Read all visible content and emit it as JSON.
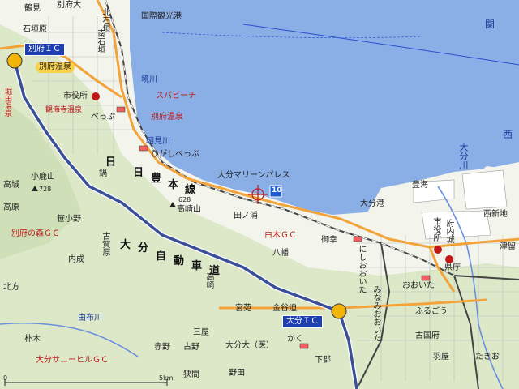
{
  "map": {
    "water_color": "#8aaee6",
    "land_color": "#f3f4ec",
    "hill_color": "#dde8c8",
    "expressway_color": "#3a4f97",
    "route_color": "#f2a33a",
    "rail_color": "#444444",
    "labels": {
      "tsurumi": "鶴見",
      "ishigakibara": "石垣原",
      "beppu_sta_n": "別府大",
      "kitaishigaki": "北石垣",
      "minamiishigaki": "南石垣",
      "kokusai_port": "国際観光港",
      "seki": "関",
      "nishi": "西",
      "sakaigawa": "境川",
      "supabeach": "スパビーチ",
      "shiyakusho_beppu": "市役所",
      "beppu_station": "べっぷ",
      "beppu_onsen_label": "別府温泉",
      "kankaiji": "観海寺温泉",
      "horita": "堀田温泉",
      "asamigawa": "朝見川",
      "higashi_beppu": "ひがしべっぷ",
      "oita_marine": "大分マリーンパレス",
      "oitagawa": "大分川",
      "takasaki": "高崎山",
      "takasaki_elev": "628",
      "kobuyama": "小鹿山",
      "kobuyama_elev": "728",
      "tanoura": "田ノ浦",
      "kashima": "鍋",
      "sasao": "笹小野",
      "koga": "古賀原",
      "beppu_forest": "別府の森ＧＣ",
      "uchinari": "内成",
      "shiraki_gc": "白木ＧＣ",
      "hachiman": "八幡",
      "gohashi": "御幸",
      "oita_port": "大分港",
      "toyoumi": "豊海",
      "nishishinchi": "西新地",
      "shiyakusho_oita": "市役所",
      "funai": "府内城",
      "kencho": "県庁",
      "tsuhara": "津留",
      "nishioita": "にしおおいた",
      "minamioita": "みなみおおいた",
      "oita_station": "おおいた",
      "furugou": "ふるごう",
      "kanaike": "金谷迫",
      "miyaen": "宮苑",
      "sanmyo": "三屋",
      "furuno": "古野",
      "akano": "赤野",
      "oita_univ": "大分大（医）",
      "kaku": "かく",
      "noda": "野田",
      "sekkasai": "狭間",
      "takahashi": "高崎",
      "yufugawa": "由布川",
      "hokaku": "朴木",
      "oita_sunny": "大分サニーヒルＧＣ",
      "kitacho": "北方",
      "shiro": "高城",
      "takabaru": "高原",
      "kogumo": "古国府",
      "tagaki": "たきお",
      "hanaka": "羽屋",
      "hon_line_1": "日",
      "hon_line_2": "豊",
      "hon_line_3": "本",
      "hon_line_4": "線",
      "oita_exp_1": "大",
      "oita_exp_2": "分",
      "oita_exp_3": "自",
      "oita_exp_4": "動",
      "oita_exp_5": "車",
      "oita_exp_6": "道",
      "route_10": "10",
      "oitagawa_river": "大分川",
      "shimotani": "下郡",
      "beppu_river_s": "鶴見"
    },
    "interchanges": {
      "beppu_ic": "別府ＩＣ",
      "beppu_onsen": "別府温泉",
      "oita_ic": "大分ＩＣ"
    },
    "scale": {
      "start": "0",
      "end": "5km"
    }
  }
}
